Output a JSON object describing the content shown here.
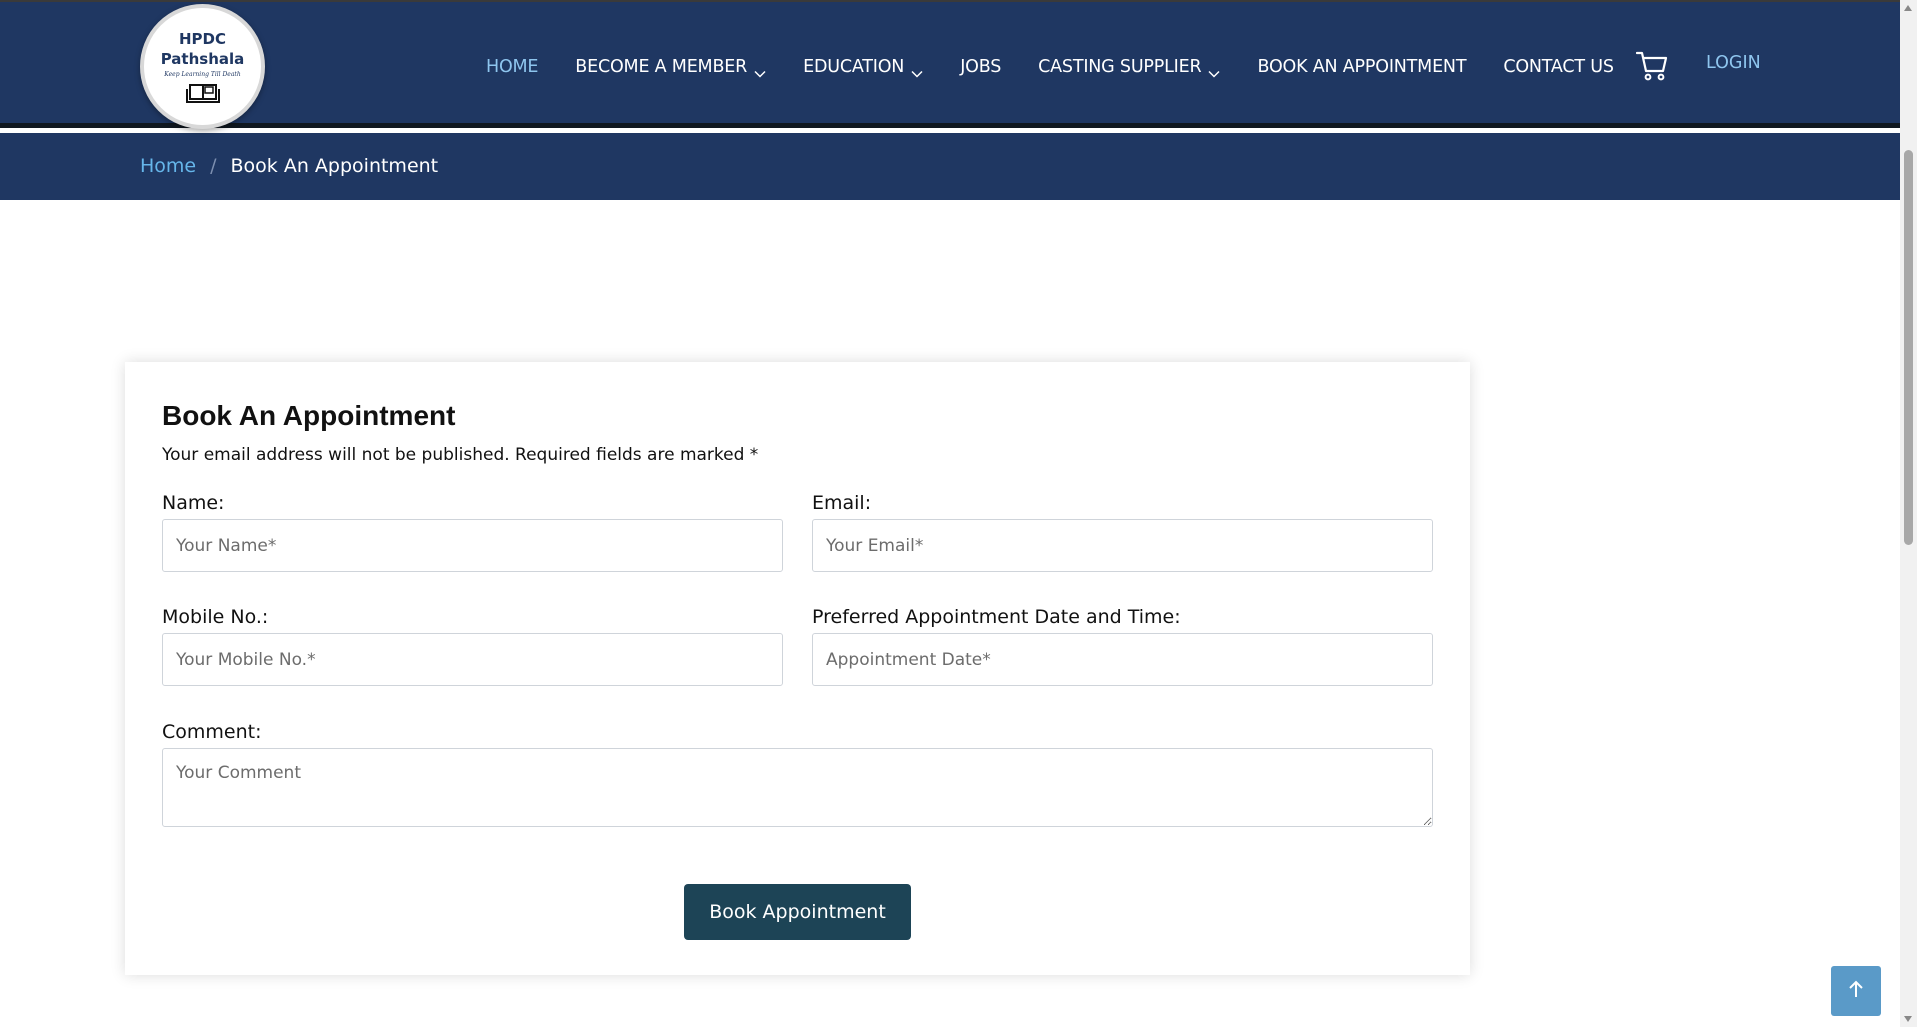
{
  "logo": {
    "line1": "HPDC",
    "line2": "Pathshala",
    "tagline": "Keep Learning Till Death",
    "icon": "book-icon"
  },
  "nav": {
    "items": [
      {
        "label": "HOME",
        "active": true,
        "dropdown": false
      },
      {
        "label": "BECOME A MEMBER",
        "active": false,
        "dropdown": true
      },
      {
        "label": "EDUCATION",
        "active": false,
        "dropdown": true
      },
      {
        "label": "JOBS",
        "active": false,
        "dropdown": false
      },
      {
        "label": "CASTING SUPPLIER",
        "active": false,
        "dropdown": true
      },
      {
        "label": "BOOK AN APPOINTMENT",
        "active": false,
        "dropdown": false
      },
      {
        "label": "CONTACT US",
        "active": false,
        "dropdown": false
      }
    ],
    "cart_icon": "cart-icon",
    "login_label": "LOGIN"
  },
  "breadcrumb": {
    "home": "Home",
    "separator": "/",
    "current": "Book An Appointment"
  },
  "form": {
    "title": "Book An Appointment",
    "note": "Your email address will not be published. Required fields are marked *",
    "name_label": "Name:",
    "name_placeholder": "Your Name*",
    "email_label": "Email:",
    "email_placeholder": "Your Email*",
    "mobile_label": "Mobile No.:",
    "mobile_placeholder": "Your Mobile No.*",
    "date_label": "Preferred Appointment Date and Time:",
    "date_placeholder": "Appointment Date*",
    "comment_label": "Comment:",
    "comment_placeholder": "Your Comment",
    "submit_label": "Book Appointment"
  },
  "colors": {
    "header_bg": "#1f3762",
    "active_link": "#8ec5ee",
    "breadcrumb_link": "#66b6ea",
    "button_bg": "#1d4456",
    "back_to_top_bg": "#5a9ac8"
  },
  "back_to_top_icon": "arrow-up-icon"
}
